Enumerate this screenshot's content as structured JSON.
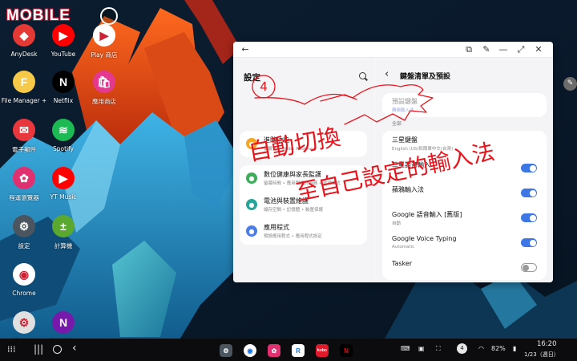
{
  "colors": {
    "accent": "#3e76e6",
    "ink_red": "#e8141c",
    "taskbar": "#0c0c0f"
  },
  "logo_text": "MOBILE",
  "desktop_apps": [
    {
      "label": "AnyDesk",
      "icon": "anydesk-icon",
      "color": "#e53935",
      "glyph": "◆"
    },
    {
      "label": "YouTube",
      "icon": "youtube-icon",
      "color": "#ff0000",
      "glyph": "▶"
    },
    {
      "label": "Play 商店",
      "icon": "play-store-icon",
      "color": "#ffffff",
      "glyph": "▶"
    },
    {
      "label": "File Manager +",
      "icon": "file-manager-icon",
      "color": "#f7c948",
      "glyph": "F"
    },
    {
      "label": "Netflix",
      "icon": "netflix-icon",
      "color": "#000000",
      "glyph": "N"
    },
    {
      "label": "應用商店",
      "icon": "galaxy-store-icon",
      "color": "#e53990",
      "glyph": "🛍"
    },
    {
      "label": "電子郵件",
      "icon": "email-icon",
      "color": "#e8383d",
      "glyph": "✉"
    },
    {
      "label": "Spotify",
      "icon": "spotify-icon",
      "color": "#1db954",
      "glyph": "≋"
    },
    {
      "label": "程運瀏覽器",
      "icon": "flower-browser-icon",
      "color": "#e0306f",
      "glyph": "✿"
    },
    {
      "label": "YT Music",
      "icon": "yt-music-icon",
      "color": "#ff0000",
      "glyph": "▶"
    },
    {
      "label": "設定",
      "icon": "settings-icon",
      "color": "#4a5560",
      "glyph": "⚙"
    },
    {
      "label": "計算機",
      "icon": "calculator-icon",
      "color": "#5aa830",
      "glyph": "±"
    },
    {
      "label": "Chrome",
      "icon": "chrome-icon",
      "color": "#ffffff",
      "glyph": "◉"
    },
    {
      "label": "Tasker",
      "icon": "tasker-icon",
      "color": "#e0e0e0",
      "glyph": "⚙"
    },
    {
      "label": "OneNote",
      "icon": "onenote-icon",
      "color": "#7719aa",
      "glyph": "N"
    }
  ],
  "settings_window": {
    "left_title": "設定",
    "left_items": [
      {
        "title": "進階功能",
        "sub": "實驗室 • Bixby Routines",
        "icon": "advanced-features-icon",
        "color": "#f5a623"
      },
      {
        "title": "數位健康與家長監護",
        "sub": "螢幕時間 • 應用程式計時器 • 就寢模式",
        "icon": "digital-wellbeing-icon",
        "color": "#3cae5a"
      },
      {
        "title": "電池與裝置維護",
        "sub": "儲存空間 • 記憶體 • 裝置保護",
        "icon": "battery-care-icon",
        "color": "#26a69a"
      },
      {
        "title": "應用程式",
        "sub": "預設應用程式 • 應用程式設定",
        "icon": "apps-icon",
        "color": "#4a7dea"
      },
      {
        "title": "一般管理",
        "sub": "語言與鍵盤 • 日期與時間",
        "icon": "general-management-icon",
        "color": "#6d7b8c"
      }
    ],
    "right_title": "鍵盤清單及預設",
    "default_keyboard": {
      "title": "預設鍵盤",
      "sub": "蘋鴉輸入法"
    },
    "section_label": "全部",
    "keyboards": [
      {
        "title": "三星鍵盤",
        "sub": "English (US)和簡單中文(台灣)",
        "toggle": null
      },
      {
        "title": "三星語音輸入",
        "sub": "",
        "toggle": "on"
      },
      {
        "title": "蘋鴉輸入法",
        "sub": "",
        "toggle": "on"
      },
      {
        "title": "Google 語音輸入 [舊版]",
        "sub": "自動",
        "toggle": "on"
      },
      {
        "title": "Google Voice Typing",
        "sub": "Automatic",
        "toggle": "on"
      },
      {
        "title": "Tasker",
        "sub": "",
        "toggle": "off"
      }
    ]
  },
  "annotation": {
    "step_number": "4",
    "line1": "自動切換",
    "line2": "至自己設定的輸入法"
  },
  "taskbar": {
    "time": "16:20",
    "date": "1/23（週日）",
    "battery": "82%",
    "notification_count": "4",
    "dock_apps": [
      {
        "icon": "settings-icon",
        "color": "#4a5560",
        "glyph": "⚙"
      },
      {
        "icon": "chrome-icon",
        "color": "#ffffff",
        "glyph": "◉"
      },
      {
        "icon": "flower-browser-icon",
        "color": "#e0306f",
        "glyph": "✿"
      },
      {
        "icon": "readmoo-icon",
        "color": "#ffffff",
        "glyph": "R"
      },
      {
        "icon": "kobo-icon",
        "color": "#e01a2b",
        "glyph": "kobo"
      },
      {
        "icon": "netflix-icon",
        "color": "#000000",
        "glyph": "N"
      }
    ]
  }
}
